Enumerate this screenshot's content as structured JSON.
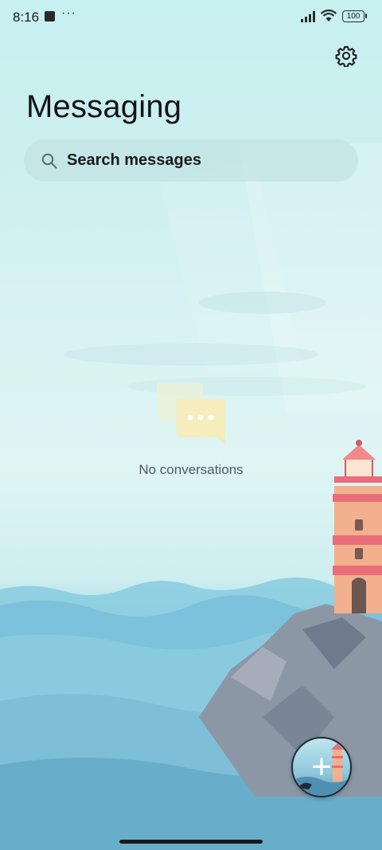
{
  "status_bar": {
    "time": "8:16",
    "overflow": "···",
    "battery": "100",
    "icons": [
      "notification-square-icon",
      "signal-icon",
      "wifi-icon",
      "battery-icon"
    ]
  },
  "header": {
    "title": "Messaging",
    "settings_icon": "gear-icon"
  },
  "search": {
    "placeholder": "Search messages",
    "icon": "search-icon"
  },
  "empty_state": {
    "message": "No conversations",
    "icon": "chat-bubbles-icon"
  },
  "fab": {
    "label": "+",
    "icon": "plus-icon"
  },
  "colors": {
    "accent": "#e96d7a",
    "text_primary": "#141414",
    "text_secondary": "#4f5a60",
    "sky": "#c7f0f1",
    "sea": "#7ec5dc"
  }
}
